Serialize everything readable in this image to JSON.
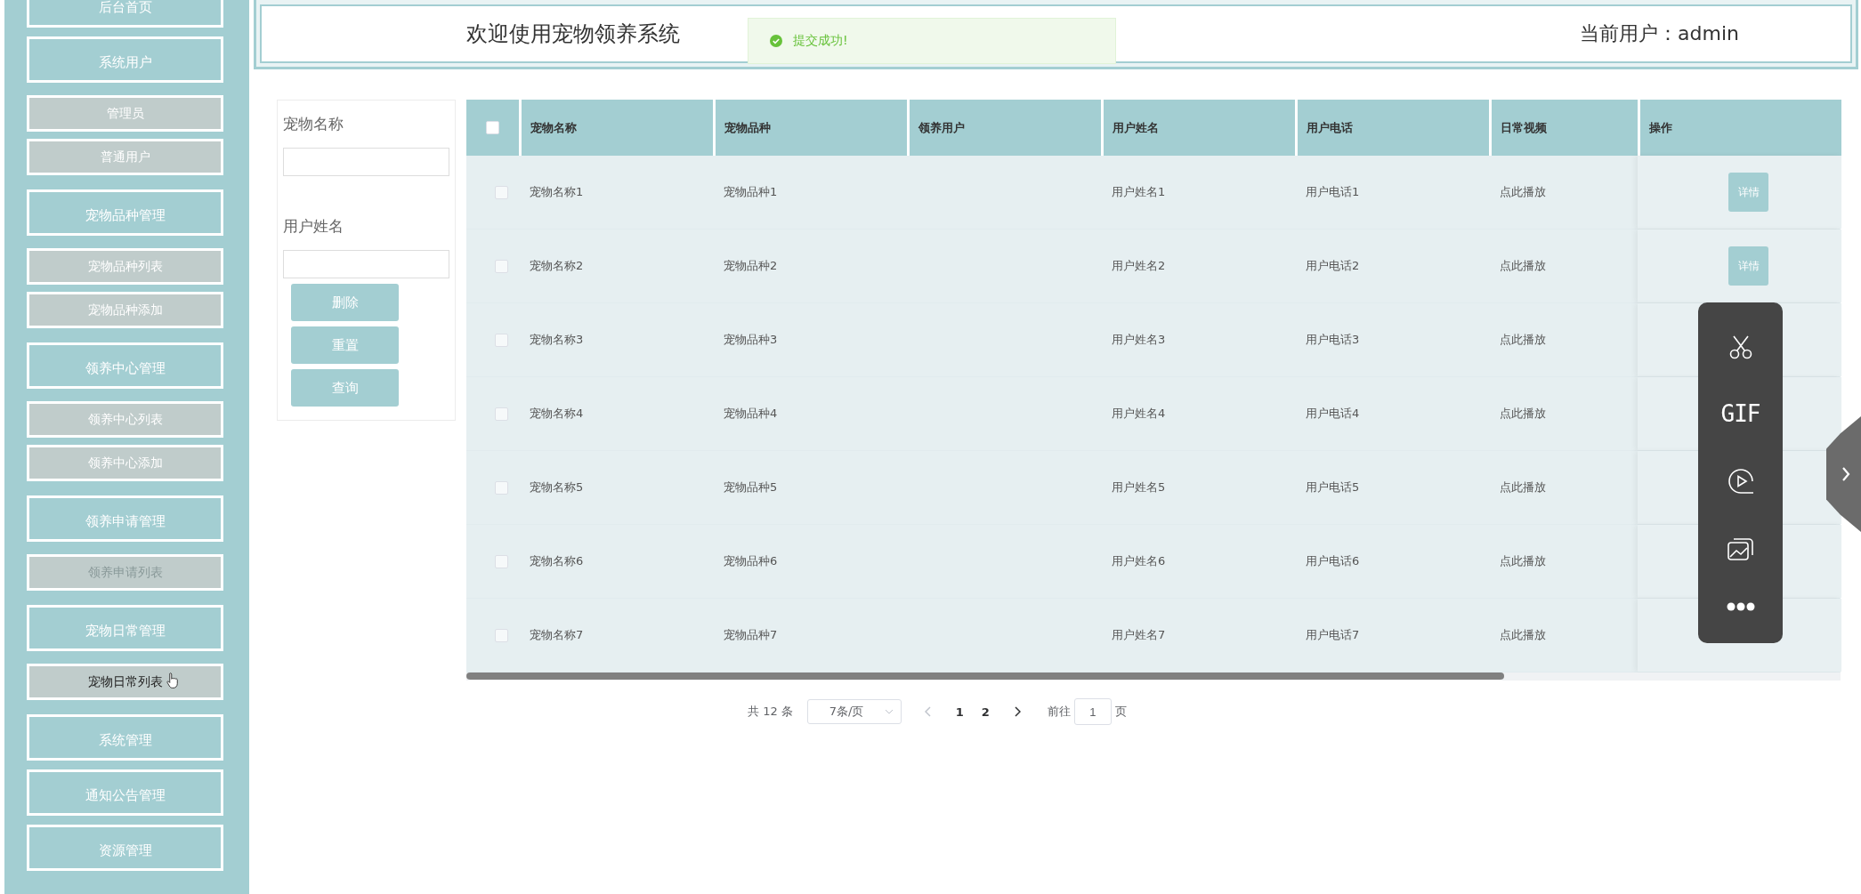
{
  "sidebar": {
    "items": [
      {
        "label": "后台首页"
      },
      {
        "label": "系统用户",
        "children": [
          {
            "label": "管理员",
            "faded": false,
            "highlighted": false
          },
          {
            "label": "普通用户",
            "faded": false,
            "highlighted": false
          }
        ]
      },
      {
        "label": "宠物品种管理",
        "children": [
          {
            "label": "宠物品种列表",
            "faded": false,
            "highlighted": false
          },
          {
            "label": "宠物品种添加",
            "faded": false,
            "highlighted": false
          }
        ]
      },
      {
        "label": "领养中心管理",
        "children": [
          {
            "label": "领养中心列表",
            "faded": false,
            "highlighted": false
          },
          {
            "label": "领养中心添加",
            "faded": false,
            "highlighted": false
          }
        ]
      },
      {
        "label": "领养申请管理",
        "children": [
          {
            "label": "领养申请列表",
            "faded": true,
            "highlighted": false
          }
        ]
      },
      {
        "label": "宠物日常管理",
        "children": [
          {
            "label": "宠物日常列表",
            "faded": false,
            "highlighted": true
          }
        ]
      },
      {
        "label": "系统管理"
      },
      {
        "label": "通知公告管理"
      },
      {
        "label": "资源管理"
      }
    ]
  },
  "header": {
    "title": "欢迎使用宠物领养系统",
    "current_user": "当前用户：admin"
  },
  "toast": {
    "kind": "success",
    "message": "提交成功!"
  },
  "search": {
    "fields": [
      {
        "label": "宠物名称"
      },
      {
        "label": "用户姓名"
      }
    ],
    "buttons": [
      "删除",
      "重置",
      "查询"
    ]
  },
  "table": {
    "select_all": {
      "checked": false
    },
    "columns": [
      "宠物名称",
      "宠物品种",
      "领养用户",
      "用户姓名",
      "用户电话",
      "日常视频",
      "操作"
    ],
    "rows": [
      {
        "checked": false,
        "pet_name": "宠物名称1",
        "breed": "宠物品种1",
        "user_name": "用户姓名1",
        "phone": "用户电话1",
        "video": "点此播放",
        "action": "详情"
      },
      {
        "checked": false,
        "pet_name": "宠物名称2",
        "breed": "宠物品种2",
        "user_name": "用户姓名2",
        "phone": "用户电话2",
        "video": "点此播放",
        "action": "详情"
      },
      {
        "checked": false,
        "pet_name": "宠物名称3",
        "breed": "宠物品种3",
        "user_name": "用户姓名3",
        "phone": "用户电话3",
        "video": "点此播放"
      },
      {
        "checked": false,
        "pet_name": "宠物名称4",
        "breed": "宠物品种4",
        "user_name": "用户姓名4",
        "phone": "用户电话4",
        "video": "点此播放"
      },
      {
        "checked": false,
        "pet_name": "宠物名称5",
        "breed": "宠物品种5",
        "user_name": "用户姓名5",
        "phone": "用户电话5",
        "video": "点此播放"
      },
      {
        "checked": false,
        "pet_name": "宠物名称6",
        "breed": "宠物品种6",
        "user_name": "用户姓名6",
        "phone": "用户电话6",
        "video": "点此播放"
      },
      {
        "checked": false,
        "pet_name": "宠物名称7",
        "breed": "宠物品种7",
        "user_name": "用户姓名7",
        "phone": "用户电话7",
        "video": "点此播放"
      }
    ]
  },
  "pagination": {
    "total": "共 12 条",
    "page_size": "7条/页",
    "prev": {
      "disabled": true
    },
    "pages": [
      "1",
      "2"
    ],
    "next": {
      "disabled": false
    },
    "goto_label": "前往",
    "goto_value": "1",
    "goto_suffix": "页"
  },
  "capture_toolbar": {
    "tools": [
      {
        "kind": "scissors"
      },
      {
        "kind": "text",
        "label": "GIF"
      },
      {
        "kind": "record"
      },
      {
        "kind": "screenshot"
      },
      {
        "kind": "more"
      }
    ]
  }
}
